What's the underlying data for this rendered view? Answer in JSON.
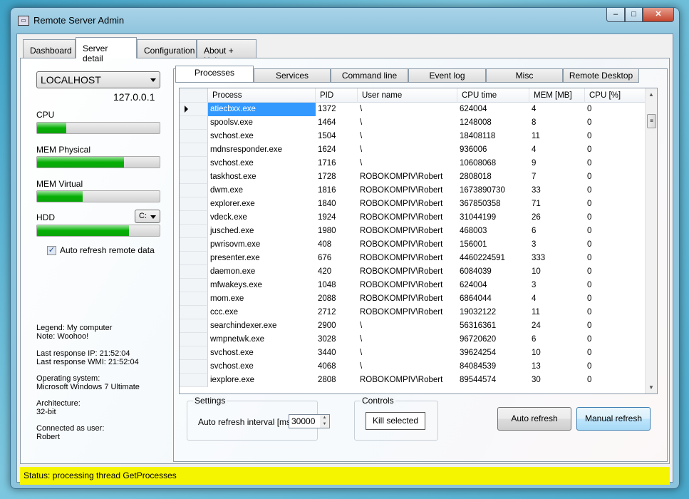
{
  "window": {
    "title": "Remote Server Admin",
    "icon": "app-icon",
    "controls": {
      "minimize": "–",
      "maximize": "□",
      "close": "✕"
    }
  },
  "main_tabs": [
    {
      "label": "Dashboard"
    },
    {
      "label": "Server detail",
      "active": true
    },
    {
      "label": "Configuration"
    },
    {
      "label": "About + Help"
    }
  ],
  "left": {
    "server": "LOCALHOST",
    "ip": "127.0.0.1",
    "meters": [
      {
        "label": "CPU",
        "percent": 24
      },
      {
        "label": "MEM Physical",
        "percent": 71
      },
      {
        "label": "MEM Virtual",
        "percent": 37
      },
      {
        "label": "HDD",
        "percent": 75
      }
    ],
    "drive": "C:",
    "auto_refresh_label": "Auto refresh remote data",
    "auto_refresh_checked": true,
    "info": {
      "legend": "Legend:  My computer",
      "note": "Note:  Woohoo!",
      "last_ip": "Last response IP:  21:52:04",
      "last_wmi": "Last response WMI:  21:52:04",
      "os_label": "Operating system:",
      "os": "Microsoft Windows 7 Ultimate",
      "arch_label": "Architecture:",
      "arch": "32-bit",
      "user_label": "Connected as user:",
      "user": "Robert"
    }
  },
  "sub_tabs": [
    {
      "label": "Processes",
      "active": true
    },
    {
      "label": "Services"
    },
    {
      "label": "Command line"
    },
    {
      "label": "Event log"
    },
    {
      "label": "Misc"
    },
    {
      "label": "Remote Desktop"
    }
  ],
  "table": {
    "columns": [
      "Process",
      "PID",
      "User name",
      "CPU time",
      "MEM [MB]",
      "CPU [%]"
    ],
    "rows": [
      [
        "atiecbxx.exe",
        "1372",
        "\\",
        "624004",
        "4",
        "0"
      ],
      [
        "spoolsv.exe",
        "1464",
        "\\",
        "1248008",
        "8",
        "0"
      ],
      [
        "svchost.exe",
        "1504",
        "\\",
        "18408118",
        "11",
        "0"
      ],
      [
        "mdnsresponder.exe",
        "1624",
        "\\",
        "936006",
        "4",
        "0"
      ],
      [
        "svchost.exe",
        "1716",
        "\\",
        "10608068",
        "9",
        "0"
      ],
      [
        "taskhost.exe",
        "1728",
        "ROBOKOMPIV\\Robert",
        "2808018",
        "7",
        "0"
      ],
      [
        "dwm.exe",
        "1816",
        "ROBOKOMPIV\\Robert",
        "1673890730",
        "33",
        "0"
      ],
      [
        "explorer.exe",
        "1840",
        "ROBOKOMPIV\\Robert",
        "367850358",
        "71",
        "0"
      ],
      [
        "vdeck.exe",
        "1924",
        "ROBOKOMPIV\\Robert",
        "31044199",
        "26",
        "0"
      ],
      [
        "jusched.exe",
        "1980",
        "ROBOKOMPIV\\Robert",
        "468003",
        "6",
        "0"
      ],
      [
        "pwrisovm.exe",
        "408",
        "ROBOKOMPIV\\Robert",
        "156001",
        "3",
        "0"
      ],
      [
        "presenter.exe",
        "676",
        "ROBOKOMPIV\\Robert",
        "4460224591",
        "333",
        "0"
      ],
      [
        "daemon.exe",
        "420",
        "ROBOKOMPIV\\Robert",
        "6084039",
        "10",
        "0"
      ],
      [
        "mfwakeys.exe",
        "1048",
        "ROBOKOMPIV\\Robert",
        "624004",
        "3",
        "0"
      ],
      [
        "mom.exe",
        "2088",
        "ROBOKOMPIV\\Robert",
        "6864044",
        "4",
        "0"
      ],
      [
        "ccc.exe",
        "2712",
        "ROBOKOMPIV\\Robert",
        "19032122",
        "11",
        "0"
      ],
      [
        "searchindexer.exe",
        "2900",
        "\\",
        "56316361",
        "24",
        "0"
      ],
      [
        "wmpnetwk.exe",
        "3028",
        "\\",
        "96720620",
        "6",
        "0"
      ],
      [
        "svchost.exe",
        "3440",
        "\\",
        "39624254",
        "10",
        "0"
      ],
      [
        "svchost.exe",
        "4068",
        "\\",
        "84084539",
        "13",
        "0"
      ],
      [
        "iexplore.exe",
        "2808",
        "ROBOKOMPIV\\Robert",
        "89544574",
        "30",
        "0"
      ]
    ]
  },
  "settings": {
    "title": "Settings",
    "interval_label": "Auto refresh interval [ms]:",
    "interval": "30000"
  },
  "controls": {
    "title": "Controls",
    "kill": "Kill selected"
  },
  "buttons": {
    "auto_refresh": "Auto refresh",
    "manual_refresh": "Manual refresh"
  },
  "status": "Status:  processing thread GetProcesses"
}
